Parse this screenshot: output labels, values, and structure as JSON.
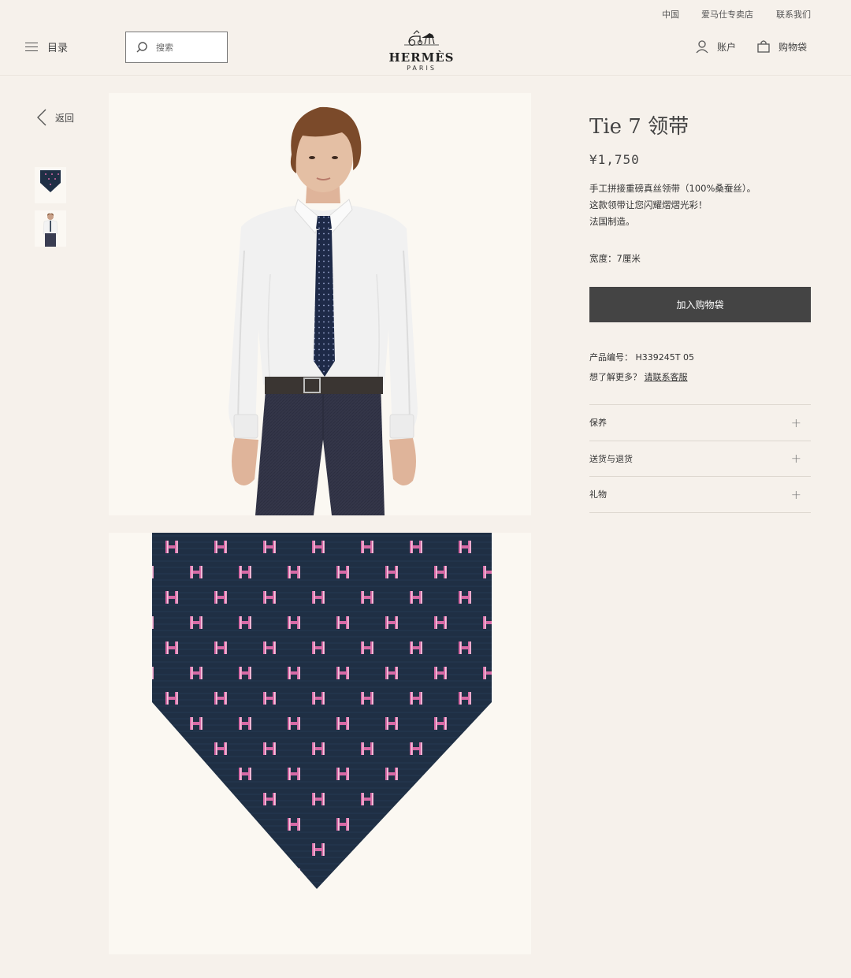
{
  "topbar": {
    "links": [
      "中国",
      "爱马仕专卖店",
      "联系我们"
    ]
  },
  "header": {
    "menu_label": "目录",
    "search_placeholder": "搜索",
    "logo_brand": "HERMÈS",
    "logo_city": "PARIS",
    "account_label": "账户",
    "bag_label": "购物袋"
  },
  "nav": {
    "back_label": "返回"
  },
  "product": {
    "title": "Tie 7 领带",
    "price": "¥1,750",
    "description": [
      "手工拼接重磅真丝领带（100%桑蚕丝）。",
      "这款领带让您闪耀熠熠光彩！",
      "法国制造。"
    ],
    "width": "宽度：7厘米",
    "add_to_bag": "加入购物袋",
    "sku_label": "产品编号：",
    "sku_value": "H339245T 05",
    "more_label": "想了解更多？",
    "more_link": "请联系客服",
    "accordion": [
      {
        "label": "保养",
        "icon": "plus-icon"
      },
      {
        "label": "送货与退货",
        "icon": "plus-icon"
      },
      {
        "label": "礼物",
        "icon": "plus-icon"
      }
    ]
  },
  "colors": {
    "background": "#f6f1eb",
    "button": "#444444",
    "tie_navy": "#1f2f45",
    "tie_pink": "#d86aa6"
  }
}
